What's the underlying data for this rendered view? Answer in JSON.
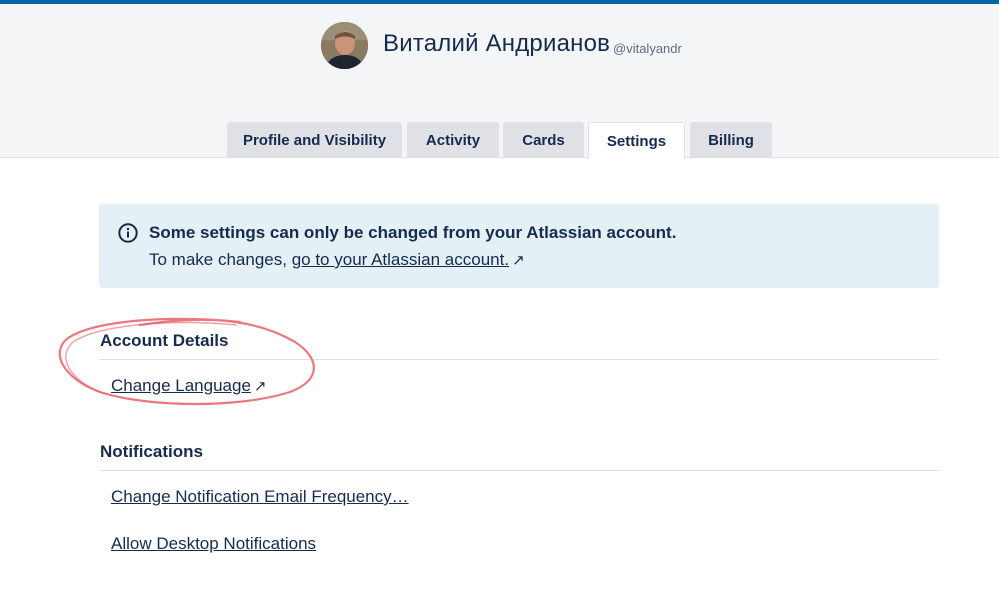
{
  "profile": {
    "name": "Виталий Андрианов",
    "username": "@vitalyandr"
  },
  "tabs": [
    {
      "label": "Profile and Visibility",
      "active": false
    },
    {
      "label": "Activity",
      "active": false
    },
    {
      "label": "Cards",
      "active": false
    },
    {
      "label": "Settings",
      "active": true
    },
    {
      "label": "Billing",
      "active": false
    }
  ],
  "banner": {
    "title": "Some settings can only be changed from your Atlassian account.",
    "text_prefix": "To make changes, ",
    "link": "go to your Atlassian account.",
    "external_icon": "↗"
  },
  "account_details": {
    "title": "Account Details",
    "links": [
      {
        "label": "Change Language",
        "external_icon": "↗"
      }
    ]
  },
  "notifications": {
    "title": "Notifications",
    "links": [
      {
        "label": "Change Notification Email Frequency…"
      },
      {
        "label": "Allow Desktop Notifications"
      }
    ]
  },
  "colors": {
    "accent_bar": "#0067a3",
    "header_bg": "#f4f5f7",
    "banner_bg": "#e4f0f6",
    "text": "#172b4d",
    "annotation": "#e8606b"
  }
}
